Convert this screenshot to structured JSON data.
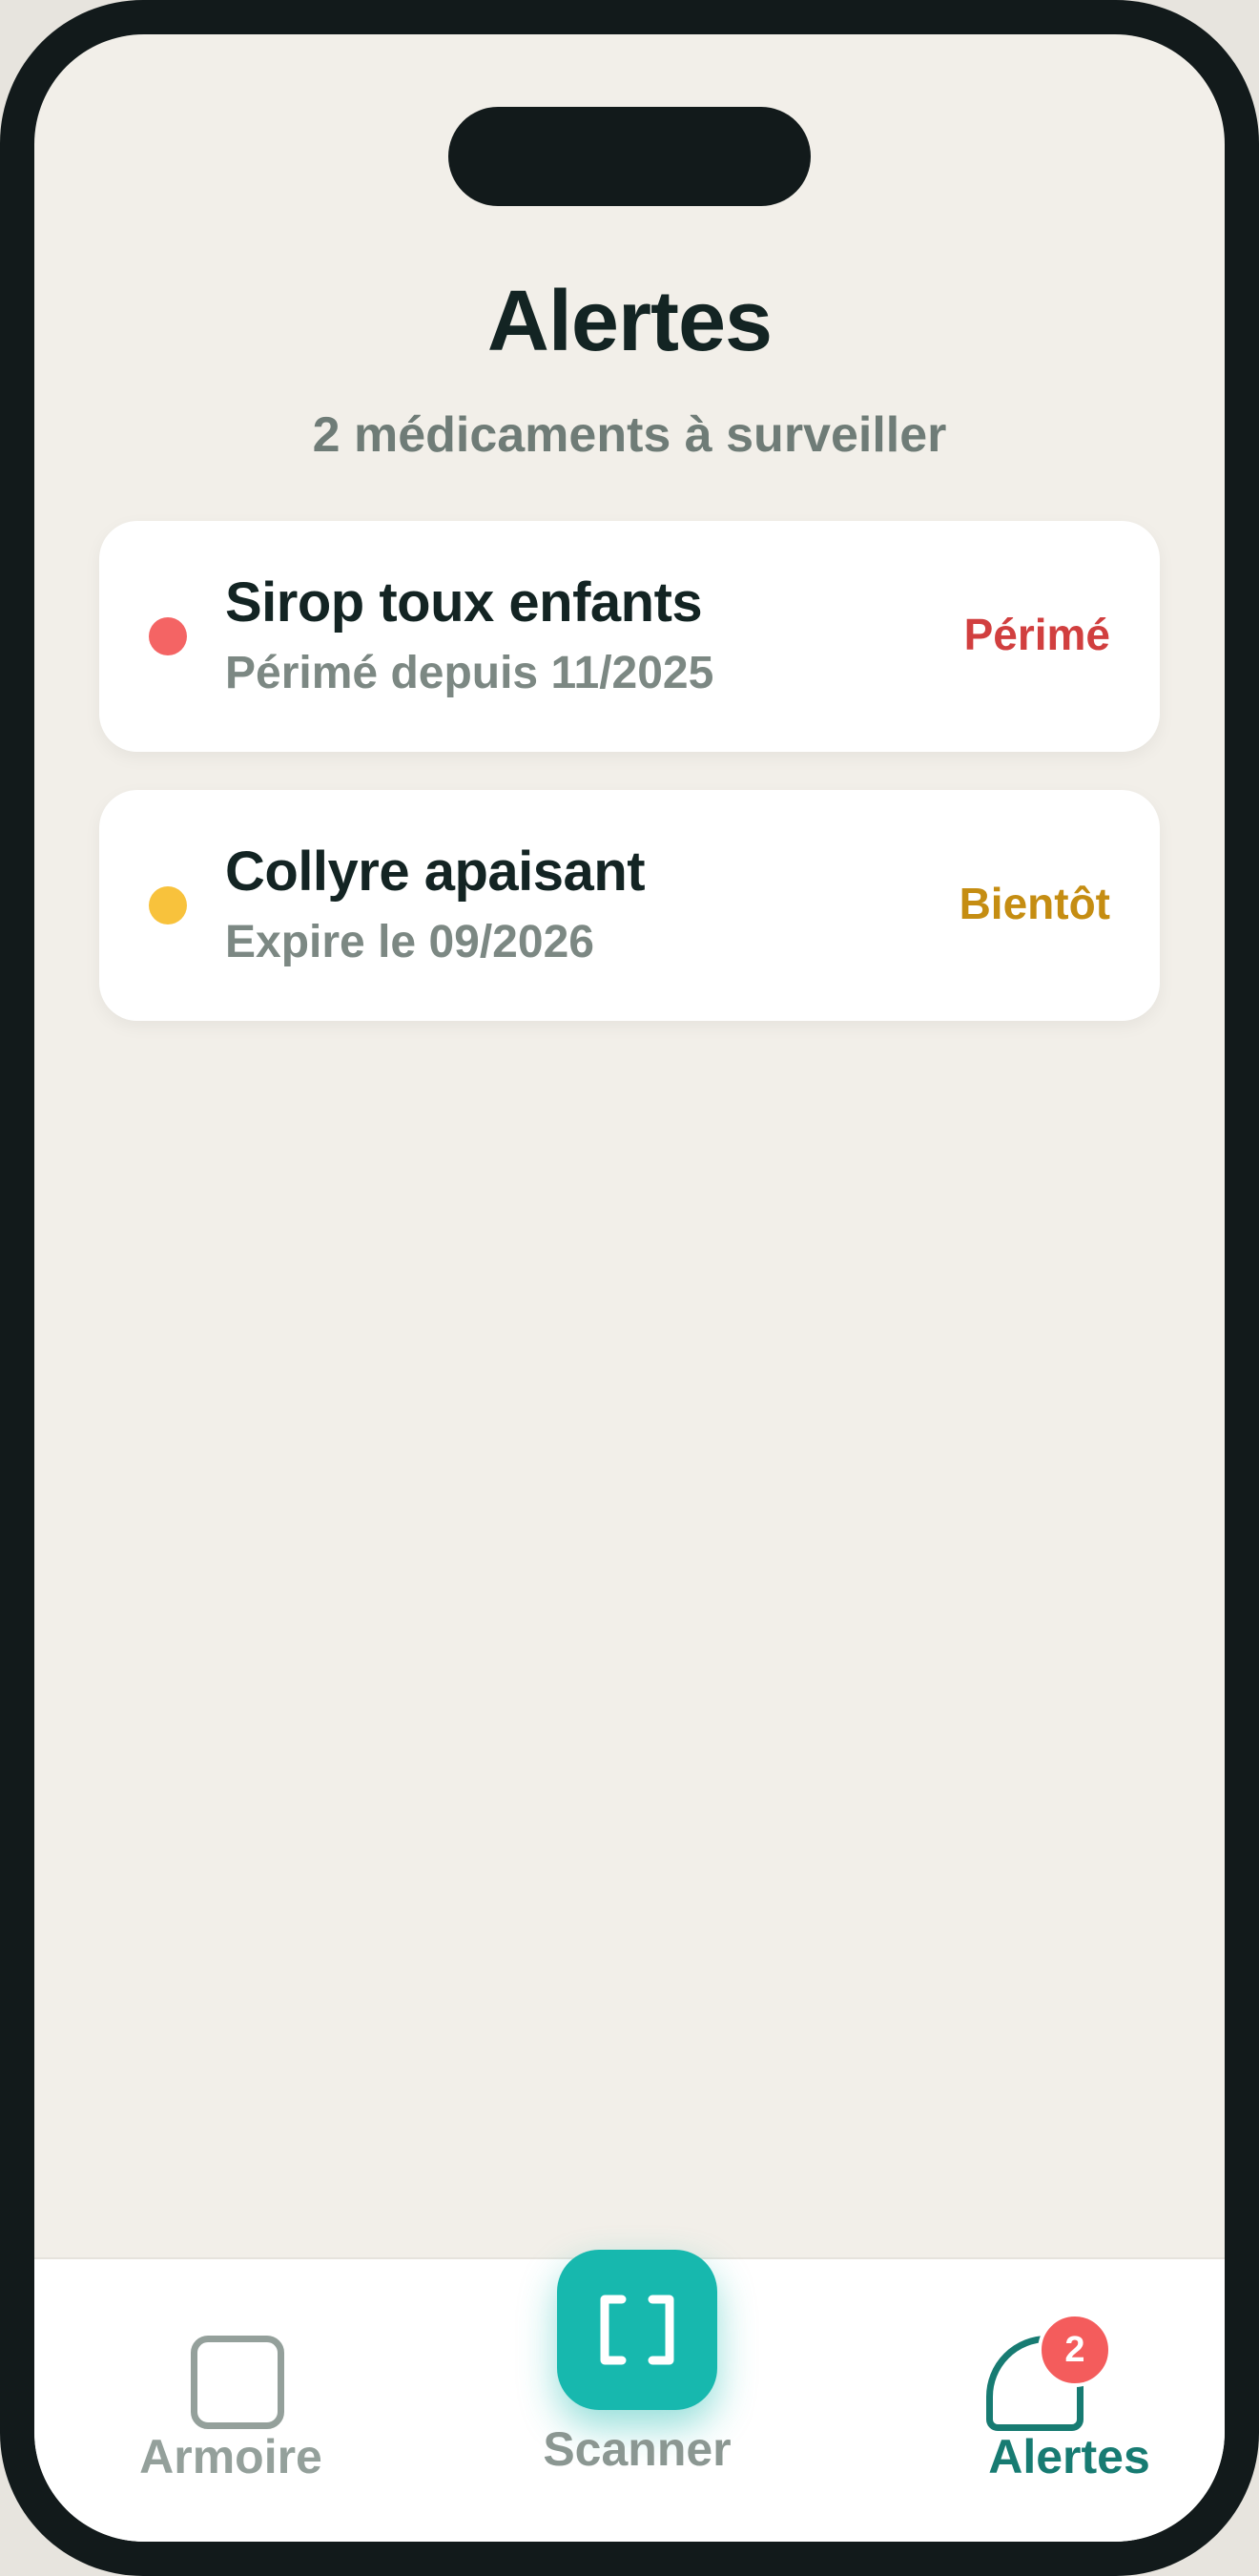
{
  "header": {
    "title": "Alertes",
    "subtitle": "2 médicaments à surveiller"
  },
  "alerts": [
    {
      "name": "Sirop toux enfants",
      "detail": "Périmé depuis 11/2025",
      "status": "Périmé",
      "dot_color": "#f46464",
      "status_color": "#d13f3f"
    },
    {
      "name": "Collyre apaisant",
      "detail": "Expire le 09/2026",
      "status": "Bientôt",
      "dot_color": "#f8c23c",
      "status_color": "#c58d12"
    }
  ],
  "nav": {
    "armoire_label": "Armoire",
    "armoire_icon": "cabinet-icon",
    "scanner_label": "Scanner",
    "scanner_icon": "scan-icon",
    "alertes_label": "Alertes",
    "alertes_icon": "bell-icon",
    "alertes_badge": "2",
    "active": "Alertes"
  },
  "colors": {
    "accent": "#17b8ae",
    "active_nav": "#177b72",
    "background": "#f2efe9"
  }
}
